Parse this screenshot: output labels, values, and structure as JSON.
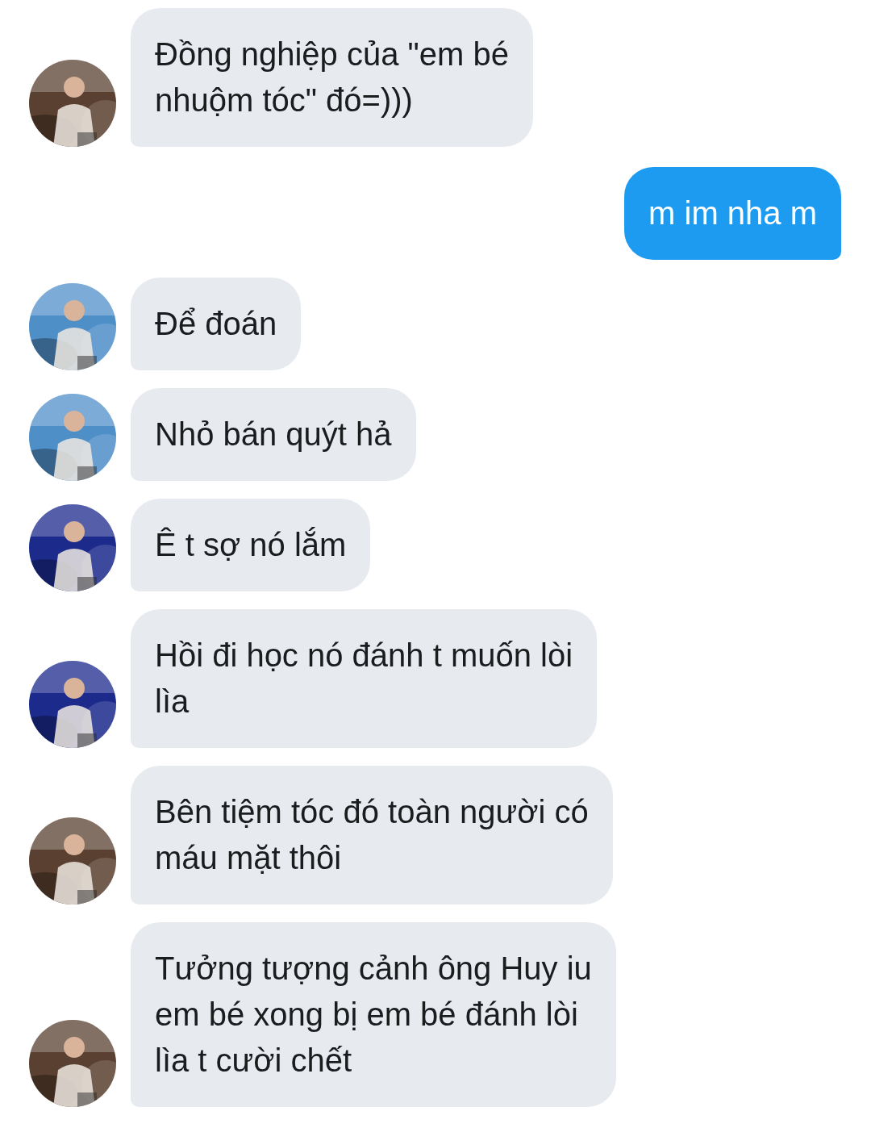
{
  "messages": [
    {
      "kind": "received",
      "text": "Đồng nghiệp của \"em bé\nnhuộm tóc\" đó=)))"
    },
    {
      "kind": "sent",
      "text": "m im nha m"
    },
    {
      "kind": "received",
      "text": "Để đoán"
    },
    {
      "kind": "received",
      "text": "Nhỏ bán quýt hả"
    },
    {
      "kind": "received",
      "text": "Ê t sợ nó lắm"
    },
    {
      "kind": "received",
      "text": "Hồi đi học nó đánh t muốn lòi\nlìa"
    },
    {
      "kind": "received",
      "text": "Bên tiệm tóc đó toàn người có\nmáu mặt thôi"
    },
    {
      "kind": "received",
      "text": "Tưởng tượng cảnh ông Huy iu\nem bé xong bị em bé đánh lòi\nlìa t cười chết"
    }
  ]
}
